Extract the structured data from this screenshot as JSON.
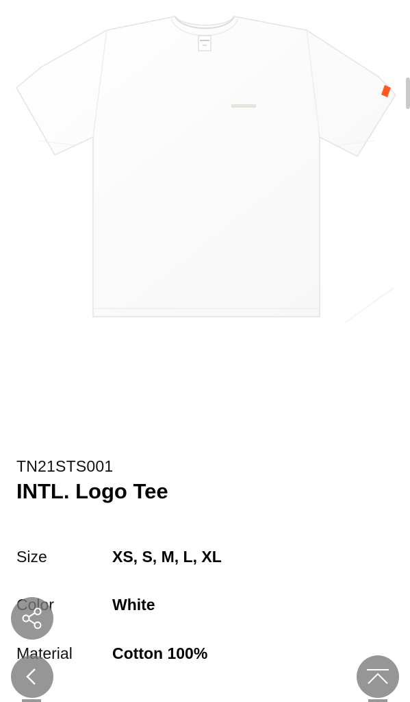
{
  "product": {
    "sku": "TN21STS001",
    "title": "INTL. Logo Tee",
    "image_alt": "White t-shirt"
  },
  "specs": [
    {
      "label": "Size",
      "value": "XS, S, M, L, XL"
    },
    {
      "label": "Color",
      "value": "White"
    },
    {
      "label": "Material",
      "value": "Cotton 100%"
    }
  ],
  "controls": {
    "share_icon": "share-icon",
    "back_icon": "chevron-left-icon",
    "top_icon": "scroll-to-top-icon"
  },
  "colors": {
    "fab_bg": "#787878",
    "sleeve_tab": "#ff5a1f",
    "shirt": "#ffffff"
  }
}
